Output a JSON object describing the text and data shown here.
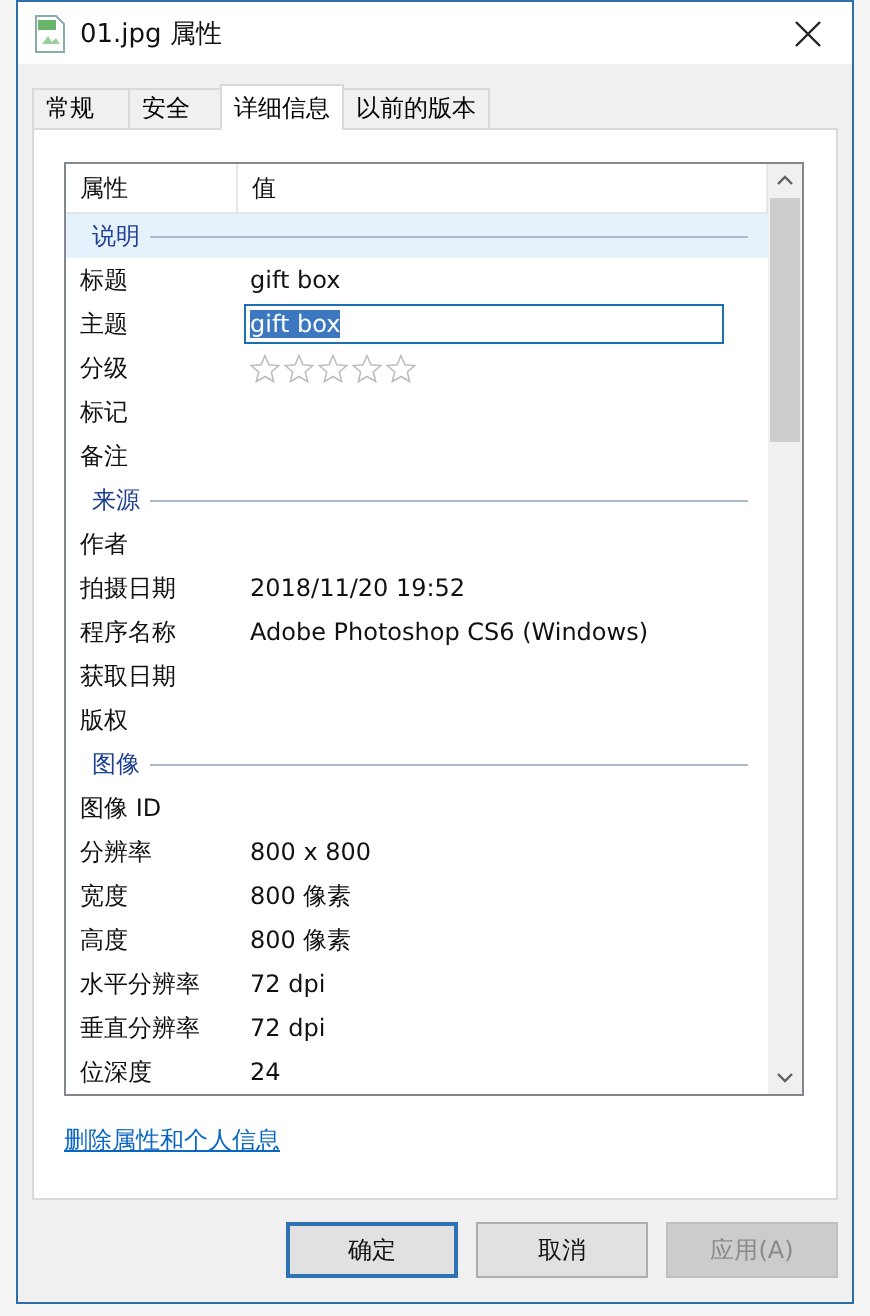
{
  "window": {
    "title": "01.jpg 属性"
  },
  "tabs": [
    {
      "label": "常规",
      "selected": false
    },
    {
      "label": "安全",
      "selected": false
    },
    {
      "label": "详细信息",
      "selected": true
    },
    {
      "label": "以前的版本",
      "selected": false
    }
  ],
  "list": {
    "columns": [
      "属性",
      "值"
    ],
    "rows": [
      {
        "kind": "section",
        "label": "说明",
        "highlighted": true
      },
      {
        "kind": "text",
        "name": "标题",
        "value": "gift box"
      },
      {
        "kind": "field",
        "name": "主题",
        "value": "gift box",
        "text_selected": true
      },
      {
        "kind": "rating",
        "name": "分级",
        "stars": 0
      },
      {
        "kind": "text",
        "name": "标记"
      },
      {
        "kind": "text",
        "name": "备注"
      },
      {
        "kind": "section",
        "label": "来源",
        "highlighted": false
      },
      {
        "kind": "text",
        "name": "作者"
      },
      {
        "kind": "text",
        "name": "拍摄日期",
        "value": "2018/11/20 19:52"
      },
      {
        "kind": "text",
        "name": "程序名称",
        "value": "Adobe Photoshop CS6 (Windows)"
      },
      {
        "kind": "text",
        "name": "获取日期"
      },
      {
        "kind": "text",
        "name": "版权"
      },
      {
        "kind": "section",
        "label": "图像",
        "highlighted": false
      },
      {
        "kind": "text",
        "name": "图像 ID"
      },
      {
        "kind": "text",
        "name": "分辨率",
        "value": "800 x 800"
      },
      {
        "kind": "text",
        "name": "宽度",
        "value": "800 像素"
      },
      {
        "kind": "text",
        "name": "高度",
        "value": "800 像素"
      },
      {
        "kind": "text",
        "name": "水平分辨率",
        "value": "72 dpi"
      },
      {
        "kind": "text",
        "name": "垂直分辨率",
        "value": "72 dpi"
      },
      {
        "kind": "text",
        "name": "位深度",
        "value": "24"
      }
    ]
  },
  "link": "删除属性和个人信息",
  "buttons": [
    {
      "label": "确定",
      "default": true,
      "disabled": false
    },
    {
      "label": "取消",
      "default": false,
      "disabled": false
    },
    {
      "label": "应用(A)",
      "default": false,
      "disabled": true
    }
  ]
}
